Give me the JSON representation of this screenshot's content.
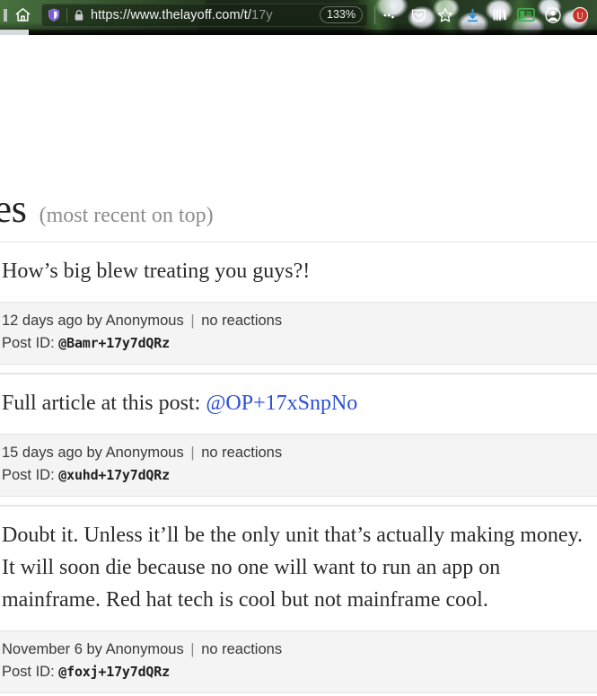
{
  "browser": {
    "home_icon": "home-icon",
    "shield_icon": "shield-icon",
    "lock_icon": "padlock-icon",
    "url_visible": "https://www.thelayoff.com/t/",
    "url_dimmed": "17y",
    "zoom_level": "133%",
    "accent_download": "#2a8fe0",
    "accent_extension": "#c8322b",
    "right_icons": [
      {
        "name": "page-actions-icon",
        "glyph": "•••"
      },
      {
        "name": "pocket-icon",
        "glyph": "pocket"
      },
      {
        "name": "bookmark-star-icon",
        "glyph": "☆"
      },
      {
        "name": "downloads-icon",
        "glyph": "download"
      },
      {
        "name": "library-icon",
        "glyph": "library"
      },
      {
        "name": "sidebar-icon",
        "glyph": "sidebar"
      },
      {
        "name": "account-icon",
        "glyph": "account"
      },
      {
        "name": "ublock-origin-icon",
        "glyph": "U"
      }
    ]
  },
  "page": {
    "heading_title": "plies",
    "heading_subtitle": "(most recent on top)",
    "posts": [
      {
        "body_text": "How’s big blew treating you guys?!",
        "link_text": "",
        "meta_date": "12 days ago",
        "meta_author": "by Anonymous",
        "meta_sep": "|",
        "meta_reactions": "no reactions",
        "postid_label": "Post ID:",
        "postid_value": "@Bamr+17y7dQRz"
      },
      {
        "body_text": "Full article at this post: ",
        "link_text": "@OP+17xSnpNo",
        "meta_date": "15 days ago",
        "meta_author": "by Anonymous",
        "meta_sep": "|",
        "meta_reactions": "no reactions",
        "postid_label": "Post ID:",
        "postid_value": "@xuhd+17y7dQRz"
      },
      {
        "body_text": "Doubt it. Unless it’ll be the only unit that’s actually making money. It will soon die because no one will want to run an app on mainframe. Red hat tech is cool but not mainframe cool.",
        "link_text": "",
        "meta_date": "November 6",
        "meta_author": "by Anonymous",
        "meta_sep": "|",
        "meta_reactions": "no reactions",
        "postid_label": "Post ID:",
        "postid_value": "@foxj+17y7dQRz"
      }
    ]
  }
}
